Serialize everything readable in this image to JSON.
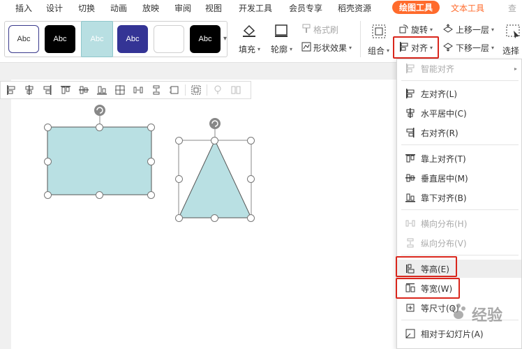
{
  "menubar": {
    "items": [
      "插入",
      "设计",
      "切换",
      "动画",
      "放映",
      "审阅",
      "视图",
      "开发工具",
      "会员专享",
      "稻壳资源"
    ],
    "active_tab": "绘图工具",
    "text_tool_tab": "文本工具",
    "search_label": "查"
  },
  "ribbon": {
    "styles": [
      {
        "label": "Abc",
        "fill": "#ffffff",
        "border": "#3a3a8c",
        "text": "#333333"
      },
      {
        "label": "Abc",
        "fill": "#000000",
        "border": "#000000",
        "text": "#ffffff"
      },
      {
        "label": "Abc",
        "fill": "#b8dfe2",
        "border": "#8fc6cb",
        "text": "#ffffff"
      },
      {
        "label": "Abc",
        "fill": "#343495",
        "border": "#343495",
        "text": "#ffffff"
      },
      {
        "label": "",
        "fill": "#ffffff",
        "border": "#d0d0d0",
        "text": "#333333"
      },
      {
        "label": "Abc",
        "fill": "#000000",
        "border": "#000000",
        "text": "#ffffff"
      }
    ],
    "fill_label": "填充",
    "outline_label": "轮廓",
    "format_brush_label": "格式刷",
    "shape_effect_label": "形状效果",
    "group_label": "组合",
    "rotate_label": "旋转",
    "align_label": "对齐",
    "bring_forward_label": "上移一层",
    "send_backward_label": "下移一层",
    "select_label": "选择"
  },
  "dropdown": {
    "smart_align": "智能对齐",
    "items": [
      {
        "label": "左对齐(L)",
        "icon": "align-left-icon",
        "disabled": false
      },
      {
        "label": "水平居中(C)",
        "icon": "align-center-h-icon",
        "disabled": false
      },
      {
        "label": "右对齐(R)",
        "icon": "align-right-icon",
        "disabled": false
      },
      {
        "label": "靠上对齐(T)",
        "icon": "align-top-icon",
        "disabled": false
      },
      {
        "label": "垂直居中(M)",
        "icon": "align-middle-v-icon",
        "disabled": false
      },
      {
        "label": "靠下对齐(B)",
        "icon": "align-bottom-icon",
        "disabled": false
      },
      {
        "label": "横向分布(H)",
        "icon": "distribute-h-icon",
        "disabled": true
      },
      {
        "label": "纵向分布(V)",
        "icon": "distribute-v-icon",
        "disabled": true
      },
      {
        "label": "等高(E)",
        "icon": "same-height-icon",
        "disabled": false
      },
      {
        "label": "等宽(W)",
        "icon": "same-width-icon",
        "disabled": false
      },
      {
        "label": "等尺寸(Q)",
        "icon": "same-size-icon",
        "disabled": false
      },
      {
        "label": "相对于幻灯片(A)",
        "icon": "relative-to-slide-icon",
        "disabled": false
      }
    ]
  },
  "watermark": "经验",
  "colors": {
    "accent": "#ff6b2c",
    "highlight_red": "#d9261c",
    "shape_fill": "#b9e0e3",
    "shape_stroke": "#555555"
  }
}
